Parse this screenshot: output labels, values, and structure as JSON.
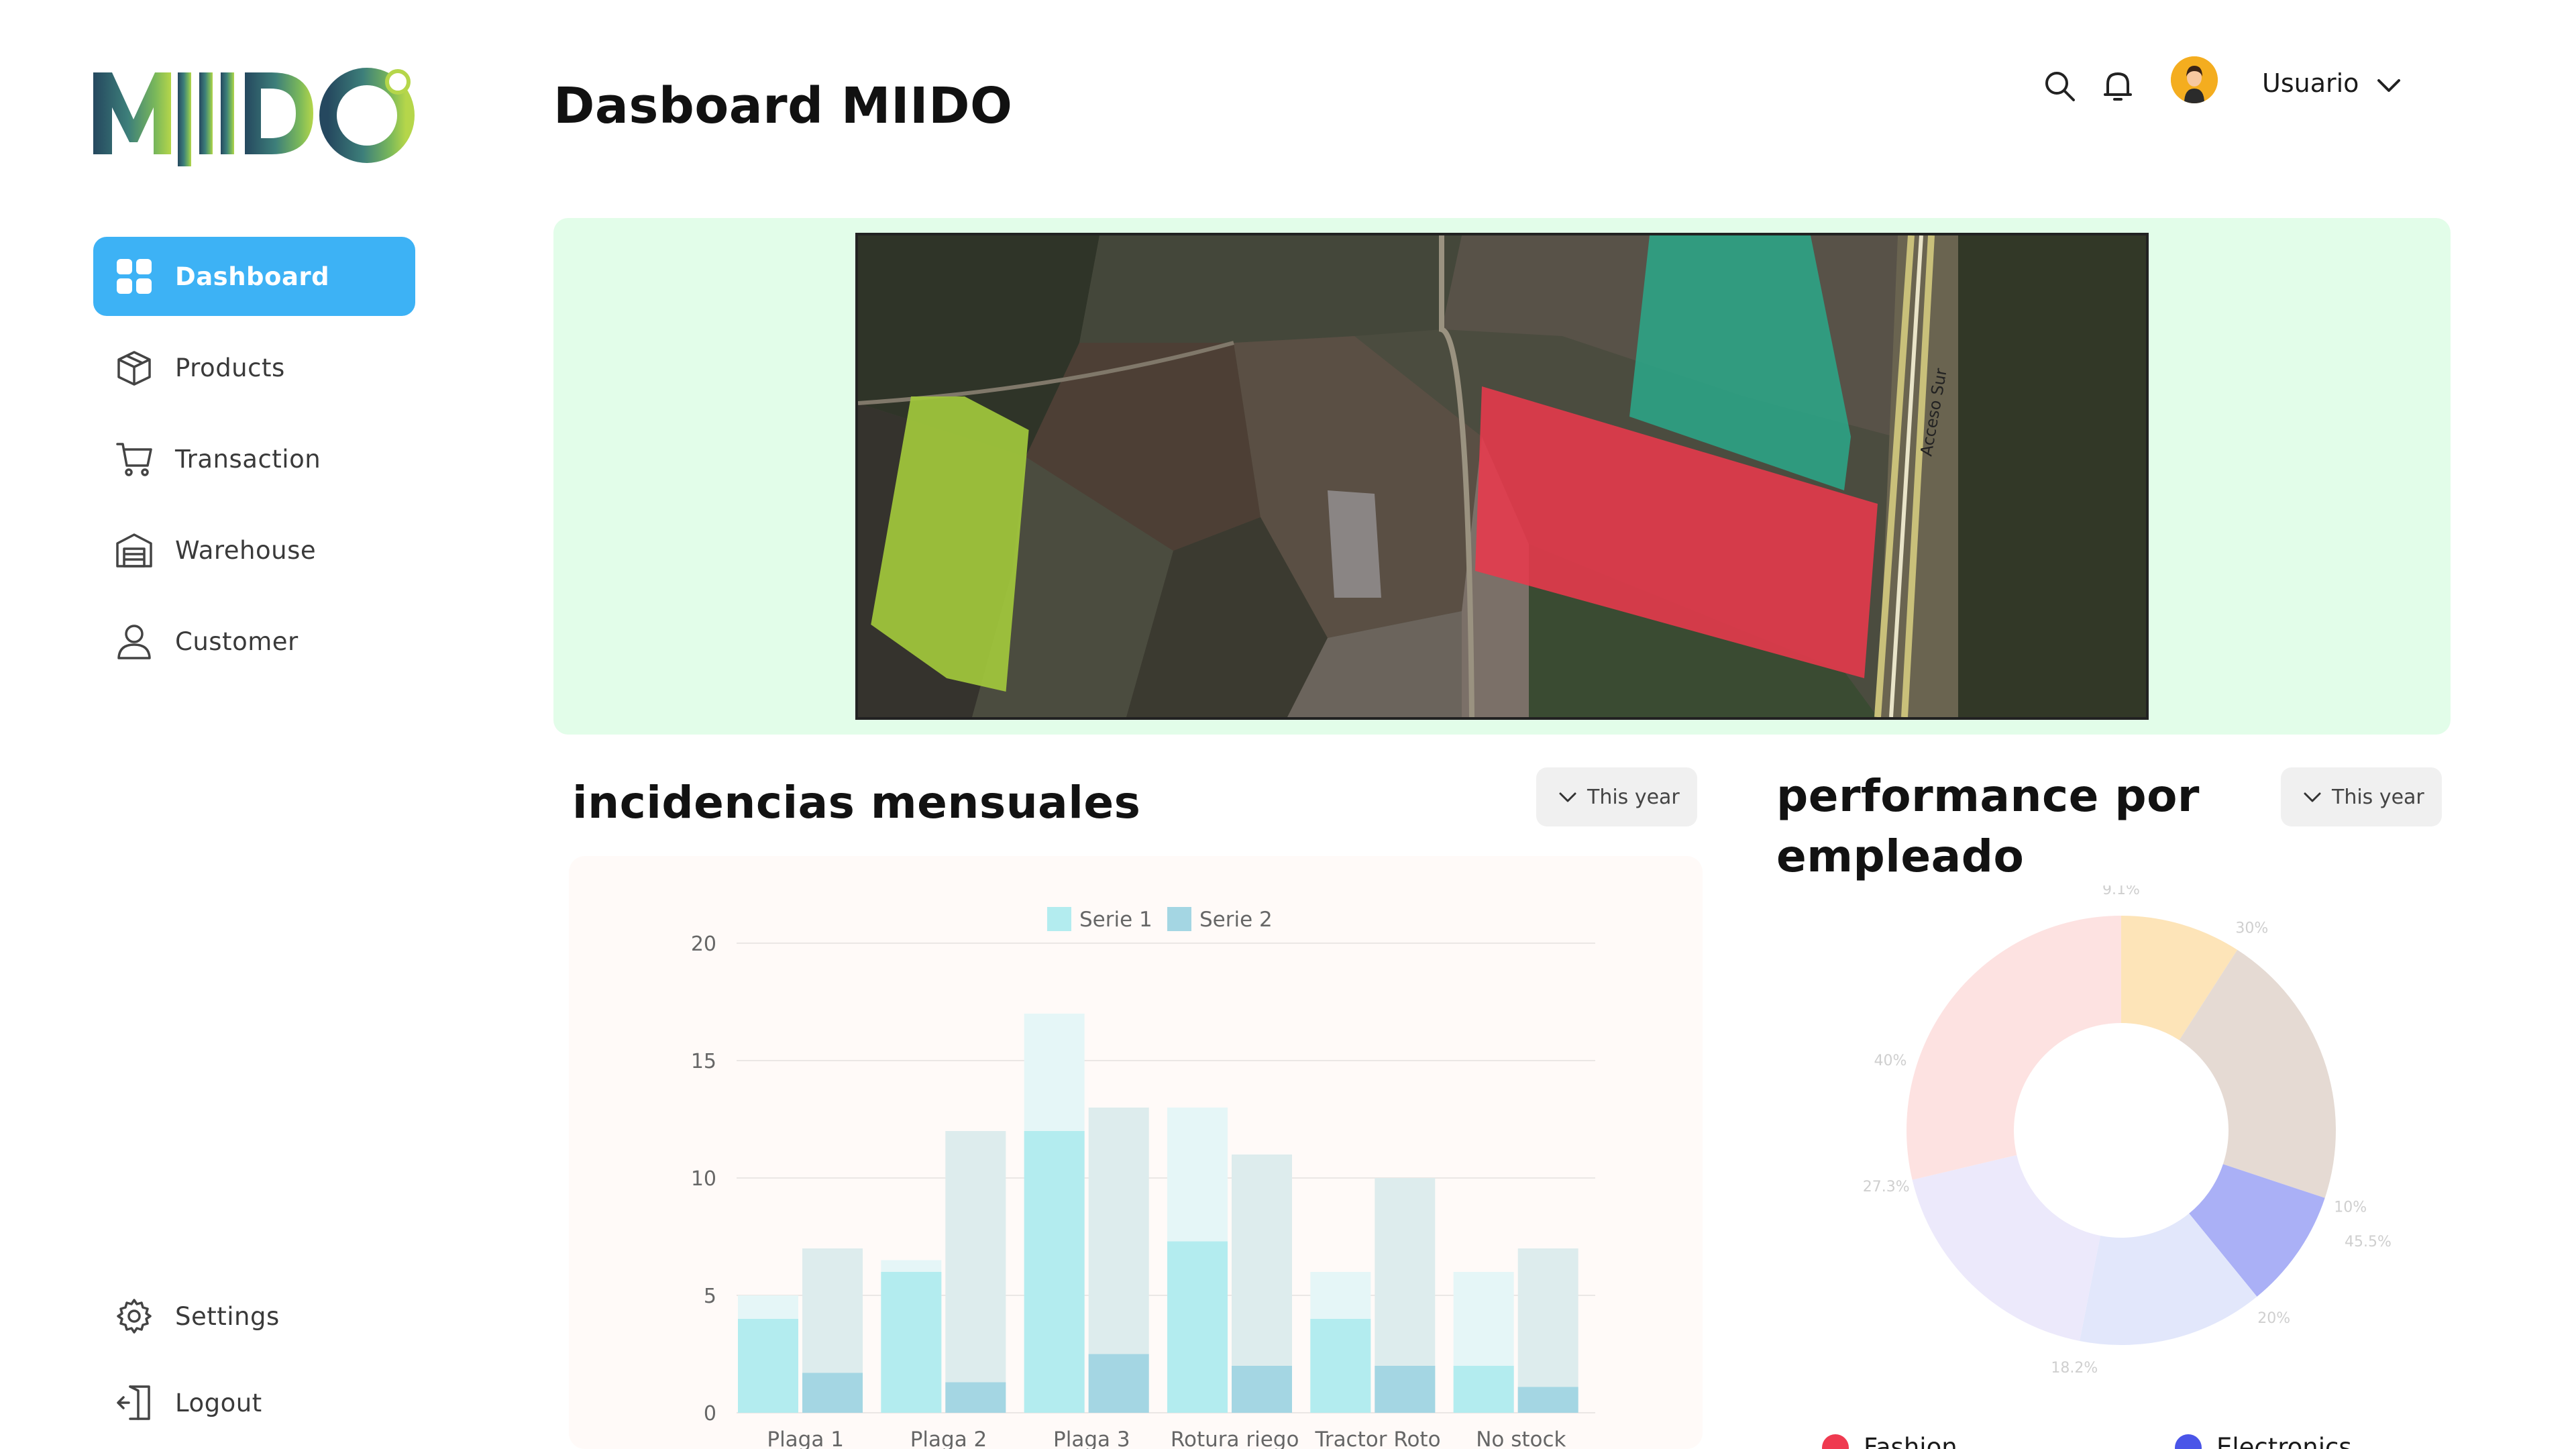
{
  "app": {
    "logo_text": "MIIDO",
    "page_title": "Dasboard MIIDO"
  },
  "sidebar": {
    "items": [
      {
        "label": "Dashboard",
        "icon": "grid-icon",
        "active": true
      },
      {
        "label": "Products",
        "icon": "box-icon",
        "active": false
      },
      {
        "label": "Transaction",
        "icon": "cart-icon",
        "active": false
      },
      {
        "label": "Warehouse",
        "icon": "warehouse-icon",
        "active": false
      },
      {
        "label": "Customer",
        "icon": "user-icon",
        "active": false
      }
    ],
    "bottom": [
      {
        "label": "Settings",
        "icon": "gear-icon"
      },
      {
        "label": "Logout",
        "icon": "logout-icon"
      }
    ]
  },
  "header": {
    "icons": [
      "search-icon",
      "bell-icon"
    ],
    "user_name": "Usuario"
  },
  "map": {
    "road_label": "Acceso Sur"
  },
  "incidencias": {
    "title": "incidencias mensuales",
    "range_label": "This year"
  },
  "performance": {
    "title_line1": "performance por",
    "title_line2": "empleado",
    "range_label": "This year"
  },
  "colors": {
    "accent": "#3db2f5",
    "map_panel_bg": "#e2fde9",
    "serie1": "#b3ecef",
    "serie2": "#a4d6e3",
    "legend_fashion": "#ef3a50",
    "legend_electronics": "#4a55e8"
  },
  "chart_data": [
    {
      "type": "bar",
      "categories": [
        "Plaga 1",
        "Plaga 2",
        "Plaga 3",
        "Rotura riego",
        "Tractor Roto",
        "No stock"
      ],
      "series": [
        {
          "name": "Serie 1",
          "values": [
            4,
            6,
            12,
            7.3,
            4,
            2
          ],
          "totals": [
            5,
            6.5,
            17,
            13,
            6,
            6
          ]
        },
        {
          "name": "Serie 2",
          "values": [
            1.7,
            1.3,
            2.5,
            2,
            2,
            1.1
          ],
          "totals": [
            7,
            12,
            13,
            11,
            10,
            7
          ]
        }
      ],
      "ylim": [
        0,
        20
      ],
      "yticks": [
        "0",
        "5",
        "10",
        "15",
        "20"
      ],
      "legend_position": "top"
    },
    {
      "type": "pie",
      "style": "donut",
      "slices": [
        {
          "label": "9.1%",
          "value": 9.1,
          "color": "#fde4b8"
        },
        {
          "label": "30%",
          "value": 21.0,
          "color": "#e5dad3"
        },
        {
          "label": "10%",
          "value": 9.0,
          "color": "#aab0f6"
        },
        {
          "label": "20%",
          "value": 14.0,
          "color": "#e2e7fb"
        },
        {
          "label": "18.2%",
          "value": 18.2,
          "color": "#ece9fb"
        },
        {
          "label": "27.3%",
          "value": 28.7,
          "color": "#fde2e1"
        }
      ],
      "extra_labels": [
        "40%",
        "45.5%"
      ],
      "legend": [
        "Fashion",
        "Electronics"
      ]
    }
  ]
}
